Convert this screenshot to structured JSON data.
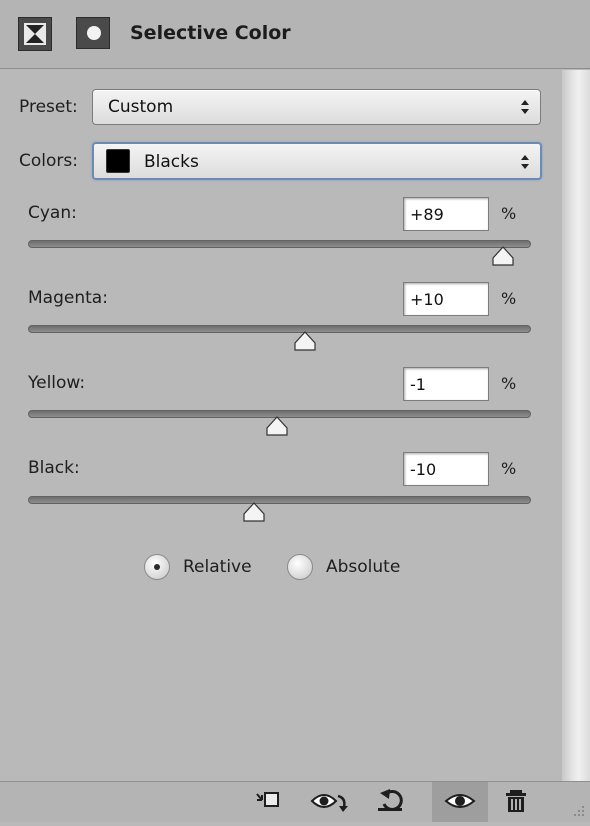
{
  "header": {
    "title": "Selective Color"
  },
  "preset": {
    "label": "Preset:",
    "value": "Custom"
  },
  "colors": {
    "label": "Colors:",
    "value": "Blacks",
    "swatch_color": "#000000"
  },
  "sliders": [
    {
      "label": "Cyan:",
      "value": "+89",
      "unit": "%",
      "level": 89
    },
    {
      "label": "Magenta:",
      "value": "+10",
      "unit": "%",
      "level": 10
    },
    {
      "label": "Yellow:",
      "value": "-1",
      "unit": "%",
      "level": -1
    },
    {
      "label": "Black:",
      "value": "-10",
      "unit": "%",
      "level": -10
    }
  ],
  "method": {
    "relative_label": "Relative",
    "absolute_label": "Absolute",
    "selected": "Relative"
  },
  "footer_icons": [
    "clip-to-layer-icon",
    "view-previous-state-icon",
    "reset-icon",
    "visibility-eye-icon",
    "trash-icon"
  ],
  "colors_theme": {
    "panel_bg": "#b9b9b9",
    "focus_border": "#6d8bb0"
  }
}
